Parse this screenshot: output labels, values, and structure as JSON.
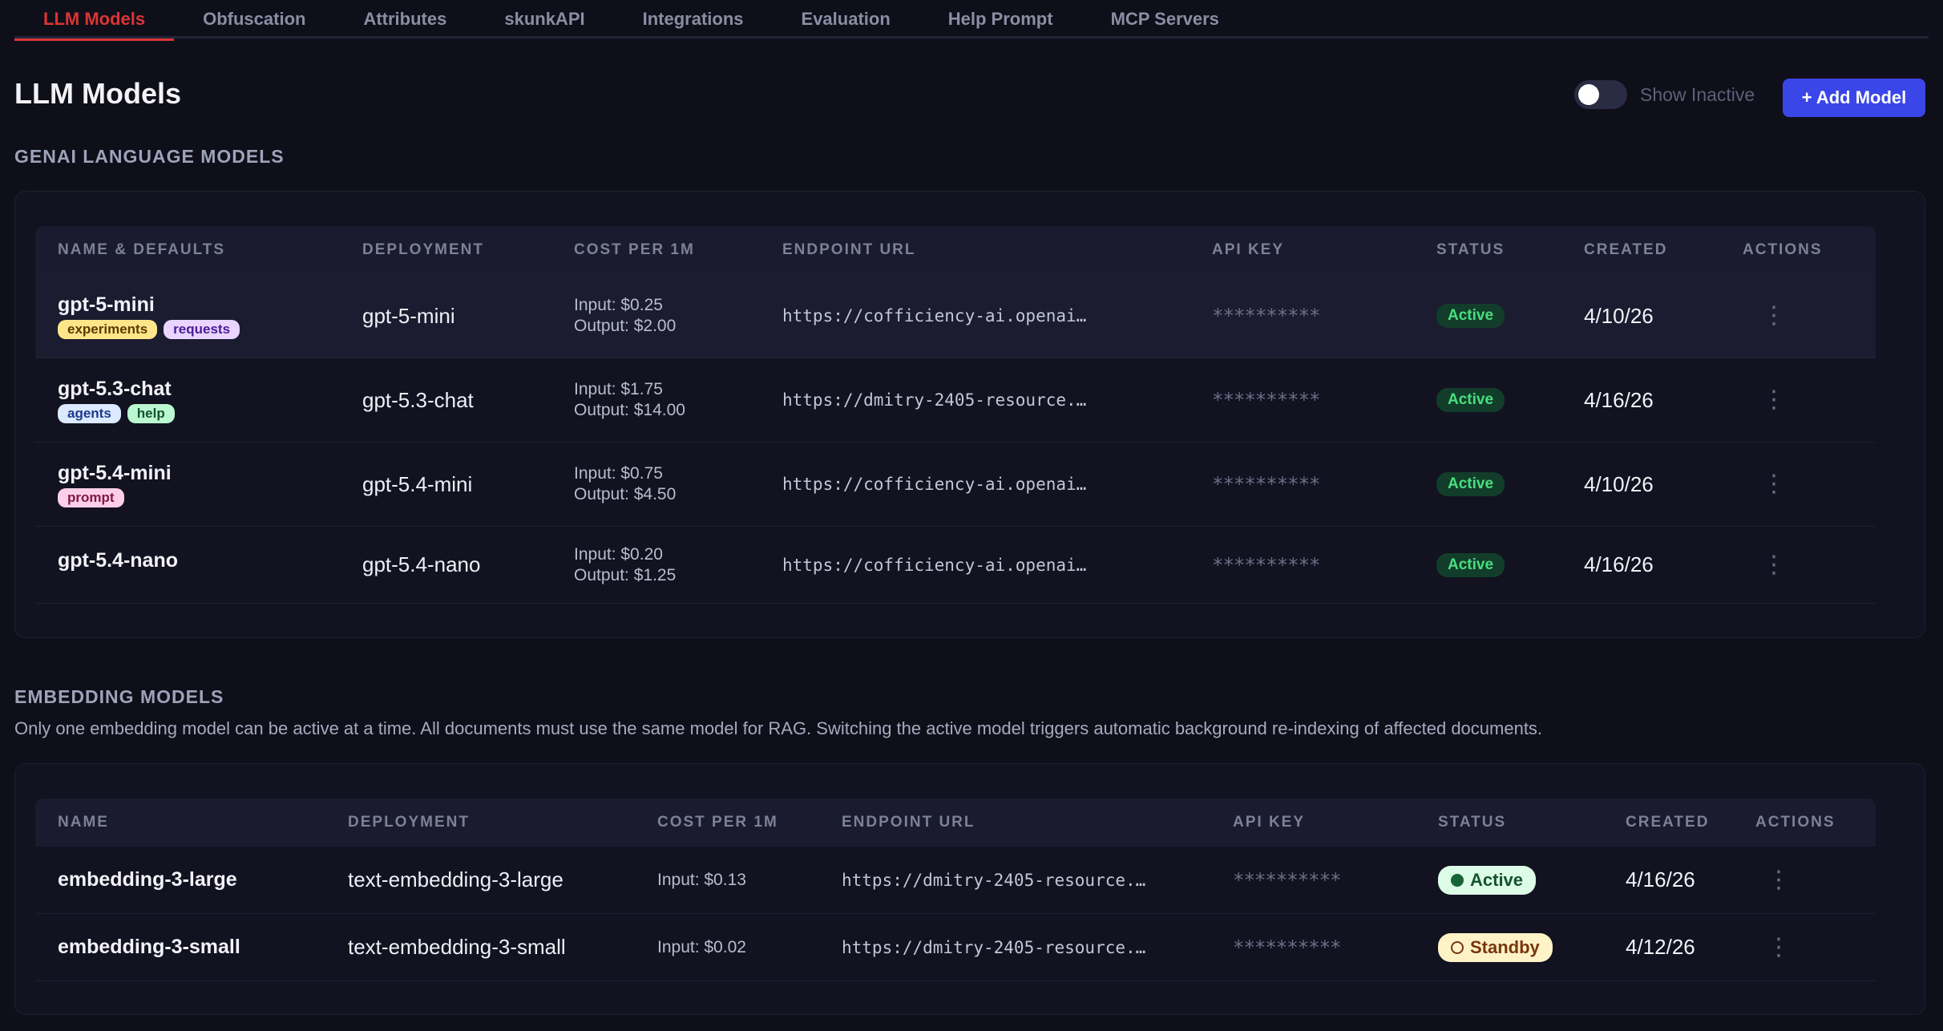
{
  "tabs": [
    {
      "label": "LLM Models",
      "active": true
    },
    {
      "label": "Obfuscation",
      "active": false
    },
    {
      "label": "Attributes",
      "active": false
    },
    {
      "label": "skunkAPI",
      "active": false
    },
    {
      "label": "Integrations",
      "active": false
    },
    {
      "label": "Evaluation",
      "active": false
    },
    {
      "label": "Help Prompt",
      "active": false
    },
    {
      "label": "MCP Servers",
      "active": false
    }
  ],
  "header": {
    "title": "LLM Models",
    "show_inactive_label": "Show Inactive",
    "show_inactive_on": false,
    "add_model_label": "+ Add Model"
  },
  "genai": {
    "heading": "GENAI LANGUAGE MODELS",
    "columns": [
      "NAME & DEFAULTS",
      "DEPLOYMENT",
      "COST PER 1M",
      "ENDPOINT URL",
      "API KEY",
      "STATUS",
      "CREATED",
      "ACTIONS"
    ],
    "rows": [
      {
        "name": "gpt-5-mini",
        "tags": [
          {
            "label": "experiments",
            "bg": "#fde68a",
            "fg": "#5a3b00"
          },
          {
            "label": "requests",
            "bg": "#e9d5ff",
            "fg": "#4c1d95"
          }
        ],
        "deployment": "gpt-5-mini",
        "cost_input": "Input:  $0.25",
        "cost_output": "Output: $2.00",
        "endpoint": "https://cofficiency-ai.openai.azure.com/",
        "api_key": "**********",
        "status": "Active",
        "created": "4/10/26"
      },
      {
        "name": "gpt-5.3-chat",
        "tags": [
          {
            "label": "agents",
            "bg": "#dbeafe",
            "fg": "#1e3a8a"
          },
          {
            "label": "help",
            "bg": "#bbf7d0",
            "fg": "#14532d"
          }
        ],
        "deployment": "gpt-5.3-chat",
        "cost_input": "Input:  $1.75",
        "cost_output": "Output: $14.00",
        "endpoint": "https://dmitry-2405-resource.openai.azure.com/",
        "api_key": "**********",
        "status": "Active",
        "created": "4/16/26"
      },
      {
        "name": "gpt-5.4-mini",
        "tags": [
          {
            "label": "prompt",
            "bg": "#fbcfe8",
            "fg": "#831843"
          }
        ],
        "deployment": "gpt-5.4-mini",
        "cost_input": "Input:  $0.75",
        "cost_output": "Output: $4.50",
        "endpoint": "https://cofficiency-ai.openai.azure.com/",
        "api_key": "**********",
        "status": "Active",
        "created": "4/10/26"
      },
      {
        "name": "gpt-5.4-nano",
        "tags": [],
        "deployment": "gpt-5.4-nano",
        "cost_input": "Input:  $0.20",
        "cost_output": "Output: $1.25",
        "endpoint": "https://cofficiency-ai.openai.azure.com/",
        "api_key": "**********",
        "status": "Active",
        "created": "4/16/26"
      }
    ]
  },
  "embedding": {
    "heading": "EMBEDDING MODELS",
    "description": "Only one embedding model can be active at a time. All documents must use the same model for RAG. Switching the active model triggers automatic background re-indexing of affected documents.",
    "columns": [
      "NAME",
      "DEPLOYMENT",
      "COST PER 1M",
      "ENDPOINT URL",
      "API KEY",
      "STATUS",
      "CREATED",
      "ACTIONS"
    ],
    "rows": [
      {
        "name": "embedding-3-large",
        "deployment": "text-embedding-3-large",
        "cost_input": "Input:  $0.13",
        "endpoint": "https://dmitry-2405-resource.openai.azure.com/",
        "api_key": "**********",
        "status": "Active",
        "status_kind": "active",
        "created": "4/16/26"
      },
      {
        "name": "embedding-3-small",
        "deployment": "text-embedding-3-small",
        "cost_input": "Input:  $0.02",
        "endpoint": "https://dmitry-2405-resource.openai.azure.com/",
        "api_key": "**********",
        "status": "Standby",
        "status_kind": "standby",
        "created": "4/12/26"
      }
    ]
  },
  "colors": {
    "accent_tab": "#dc3434",
    "primary_button": "#3b46e8",
    "active_green": "#4ade80",
    "active_large_bg": "#dcfce7",
    "active_large_fg": "#14532d",
    "standby_bg": "#fef3c7",
    "standby_fg": "#78350f"
  }
}
